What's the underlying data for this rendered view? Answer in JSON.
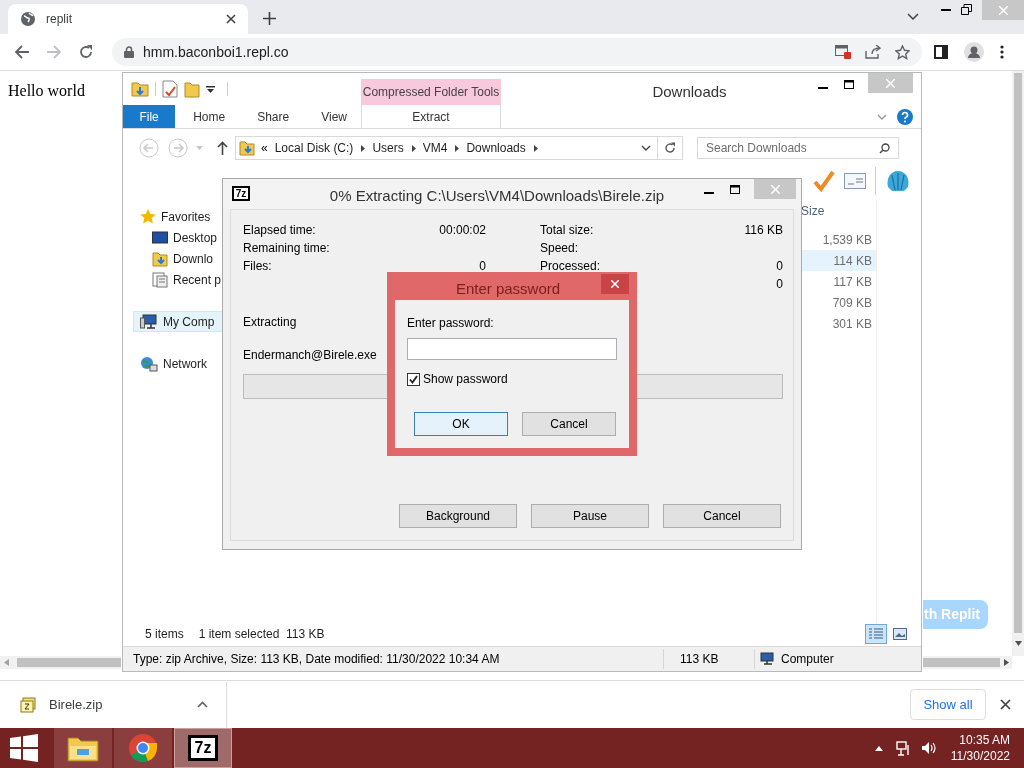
{
  "browser": {
    "tab_title": "replit",
    "url": "hmm.baconboi1.repl.co"
  },
  "page": {
    "heading": "Hello world",
    "button_text": "th Replit"
  },
  "explorer": {
    "title": "Downloads",
    "context_group": "Compressed Folder Tools",
    "ribbon_tabs": [
      {
        "label": "File",
        "kind": "file"
      },
      {
        "label": "Home",
        "kind": "tab"
      },
      {
        "label": "Share",
        "kind": "tab"
      },
      {
        "label": "View",
        "kind": "tab"
      },
      {
        "label": "Extract",
        "kind": "context"
      }
    ],
    "breadcrumb_prefix": "«",
    "breadcrumb": [
      "Local Disk (C:)",
      "Users",
      "VM4",
      "Downloads"
    ],
    "search_placeholder": "Search Downloads",
    "nav": [
      {
        "label": "Favorites",
        "kind": "star",
        "selected": false,
        "children": [
          {
            "label": "Desktop",
            "kind": "desktop",
            "selected": false
          },
          {
            "label": "Downlo",
            "kind": "downloads",
            "selected": false
          },
          {
            "label": "Recent p",
            "kind": "recent",
            "selected": false
          }
        ]
      },
      {
        "label": "My Comp",
        "kind": "computer",
        "selected": true
      },
      {
        "label": "Network",
        "kind": "network",
        "selected": false
      }
    ],
    "size_header": "Size",
    "sizes": [
      {
        "text": "1,539 KB",
        "selected": false
      },
      {
        "text": "114 KB",
        "selected": true
      },
      {
        "text": "117 KB",
        "selected": false
      },
      {
        "text": "709 KB",
        "selected": false
      },
      {
        "text": "301 KB",
        "selected": false
      }
    ],
    "item_count": "5 items",
    "selection": "1 item selected  113 KB",
    "details": {
      "info": "Type: zip Archive, Size: 113 KB, Date modified: 11/30/2022 10:34 AM",
      "size": "113 KB",
      "location": "Computer"
    }
  },
  "extract_dialog": {
    "icon_label": "7z",
    "title": "0% Extracting C:\\Users\\VM4\\Downloads\\Birele.zip",
    "stats_left": [
      {
        "label": "Elapsed time:",
        "value": "00:00:02"
      },
      {
        "label": "Remaining time:"
      },
      {
        "label": "Files:",
        "value": "0"
      }
    ],
    "stats_right": [
      {
        "label": "Total size:",
        "value": "116 KB"
      },
      {
        "label": "Speed:"
      },
      {
        "label": "Processed:",
        "value": "0"
      },
      {
        "value": "0"
      }
    ],
    "status": "Extracting",
    "file": "Endermanch@Birele.exe",
    "progress": {
      "level": 0
    },
    "buttons": [
      "Background",
      "Pause",
      "Cancel"
    ]
  },
  "password_dialog": {
    "title": "Enter password",
    "label": "Enter password:",
    "show_password": {
      "label": "Show password",
      "checked": true
    },
    "buttons": [
      {
        "label": "OK",
        "default": true
      },
      {
        "label": "Cancel",
        "default": false
      }
    ]
  },
  "downloads_bar": {
    "file": "Birele.zip",
    "show_all": "Show all"
  },
  "taskbar": {
    "apps": [
      {
        "kind": "explorer",
        "selected": false
      },
      {
        "kind": "chrome",
        "selected": false
      },
      {
        "kind": "sevenzip",
        "label": "7z",
        "selected": true
      }
    ],
    "time": "10:35 AM",
    "date": "11/30/2022"
  }
}
